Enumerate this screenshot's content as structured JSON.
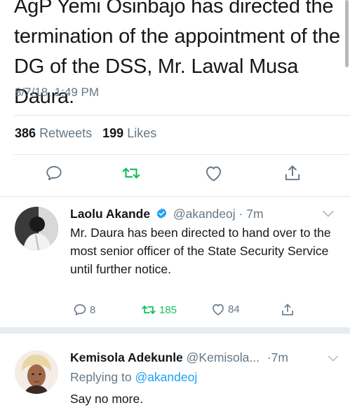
{
  "main_tweet": {
    "text": "AgP Yemi Osinbajo has directed the termination of the appointment of the DG of the DSS, Mr. Lawal Musa Daura.",
    "timestamp": "8/7/18, 1:49 PM",
    "retweet_count": "386",
    "retweet_label": "Retweets",
    "like_count": "199",
    "like_label": "Likes"
  },
  "icons": {
    "reply": "reply-icon",
    "retweet": "retweet-icon",
    "like": "heart-icon",
    "share": "share-icon",
    "verified": "verified-badge-icon",
    "more": "chevron-down-icon"
  },
  "colors": {
    "text": "#14171a",
    "secondary": "#657786",
    "accent": "#1da1f2",
    "retweet_green": "#17bf63",
    "divider": "#e1e8ed"
  },
  "replies": [
    {
      "name": "Laolu Akande",
      "handle": "@akandeoj",
      "time": "· 7m",
      "verified": true,
      "text": "Mr. Daura has been directed to hand over to the most senior officer of the State Security Service until further notice.",
      "reply_count": "8",
      "retweet_count": "185",
      "like_count": "84"
    },
    {
      "name": "Kemisola Adekunle",
      "handle": "@Kemisola...",
      "time": "·7m",
      "replying_prefix": "Replying to",
      "replying_to": "@akandeoj",
      "text": "Say no more."
    }
  ]
}
